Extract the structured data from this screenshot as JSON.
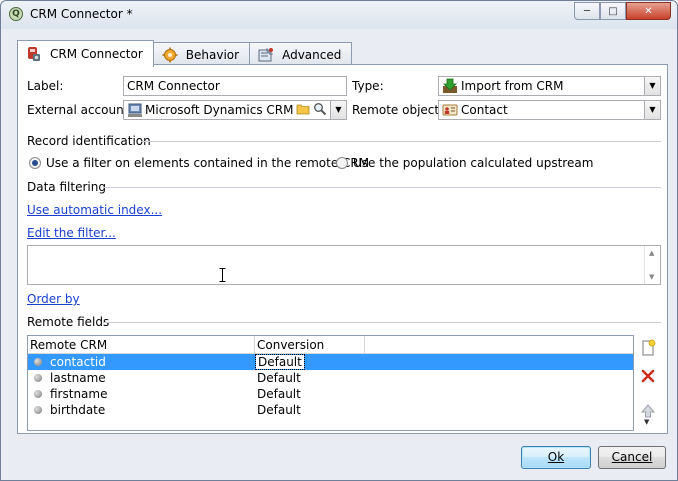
{
  "window": {
    "title": "CRM Connector *"
  },
  "tabs": [
    {
      "label": "CRM Connector",
      "icon": "crm-connector-icon"
    },
    {
      "label": "Behavior",
      "icon": "gear-icon"
    },
    {
      "label": "Advanced",
      "icon": "settings-wrench-icon"
    }
  ],
  "form": {
    "label_caption": "Label:",
    "label_value": "CRM Connector",
    "type_caption": "Type:",
    "type_value": "Import from CRM",
    "external_account_caption": "External account:",
    "external_account_value": "Microsoft Dynamics CRM",
    "remote_object_caption": "Remote object:",
    "remote_object_value": "Contact"
  },
  "record_identification": {
    "title": "Record identification",
    "option1": "Use a filter on elements contained in the remote CRM",
    "option2": "Use the population calculated upstream",
    "selected": "option1"
  },
  "data_filtering": {
    "title": "Data filtering",
    "auto_index_link": "Use automatic index...",
    "edit_filter_link": "Edit the filter...",
    "order_by_link": "Order by"
  },
  "remote_fields": {
    "title": "Remote fields",
    "columns": [
      "Remote CRM",
      "Conversion"
    ],
    "rows": [
      {
        "name": "contactid",
        "conversion": "Default",
        "selected": true
      },
      {
        "name": "lastname",
        "conversion": "Default",
        "selected": false
      },
      {
        "name": "firstname",
        "conversion": "Default",
        "selected": false
      },
      {
        "name": "birthdate",
        "conversion": "Default",
        "selected": false
      }
    ]
  },
  "buttons": {
    "ok": "Ok",
    "cancel": "Cancel"
  },
  "colors": {
    "selection": "#3399ff",
    "link": "#1a3fd0",
    "window_bg": "#e9ecf2"
  }
}
